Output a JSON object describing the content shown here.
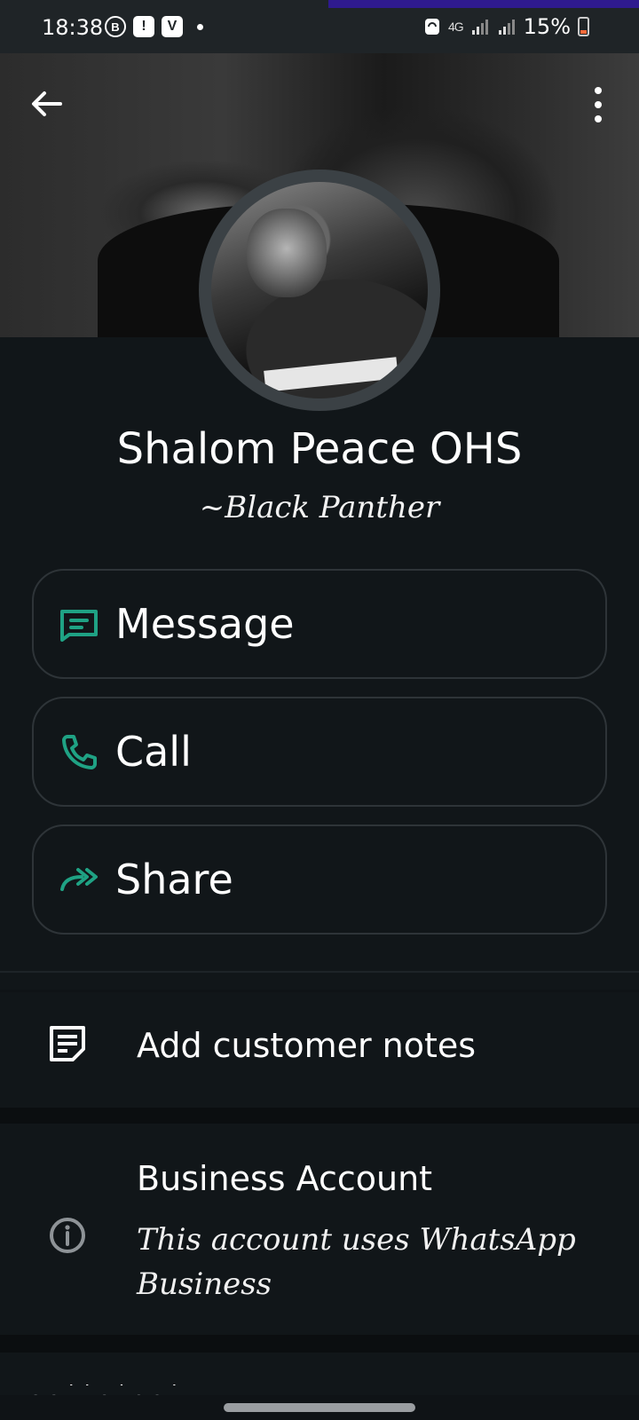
{
  "status_bar": {
    "time": "18:38",
    "left_badges": [
      "B",
      "!",
      "V"
    ],
    "network": "4G",
    "battery_percent": "15%",
    "battery_level": 0.15,
    "accent_color": "#2f1a8e"
  },
  "header": {
    "back_icon": "arrow-left-icon",
    "menu_icon": "more-vert-icon"
  },
  "profile": {
    "name": "Shalom Peace OHS",
    "about": "~Black Panther"
  },
  "actions": [
    {
      "label": "Message",
      "icon": "message-icon"
    },
    {
      "label": "Call",
      "icon": "phone-icon"
    },
    {
      "label": "Share",
      "icon": "share-icon"
    }
  ],
  "notes": {
    "label": "Add customer notes",
    "icon": "notes-icon"
  },
  "business": {
    "title": "Business Account",
    "description": "This account uses WhatsApp Business",
    "icon": "info-icon"
  },
  "colors": {
    "accent_green": "#1fa284",
    "background": "#111619",
    "border": "#2e3438"
  }
}
